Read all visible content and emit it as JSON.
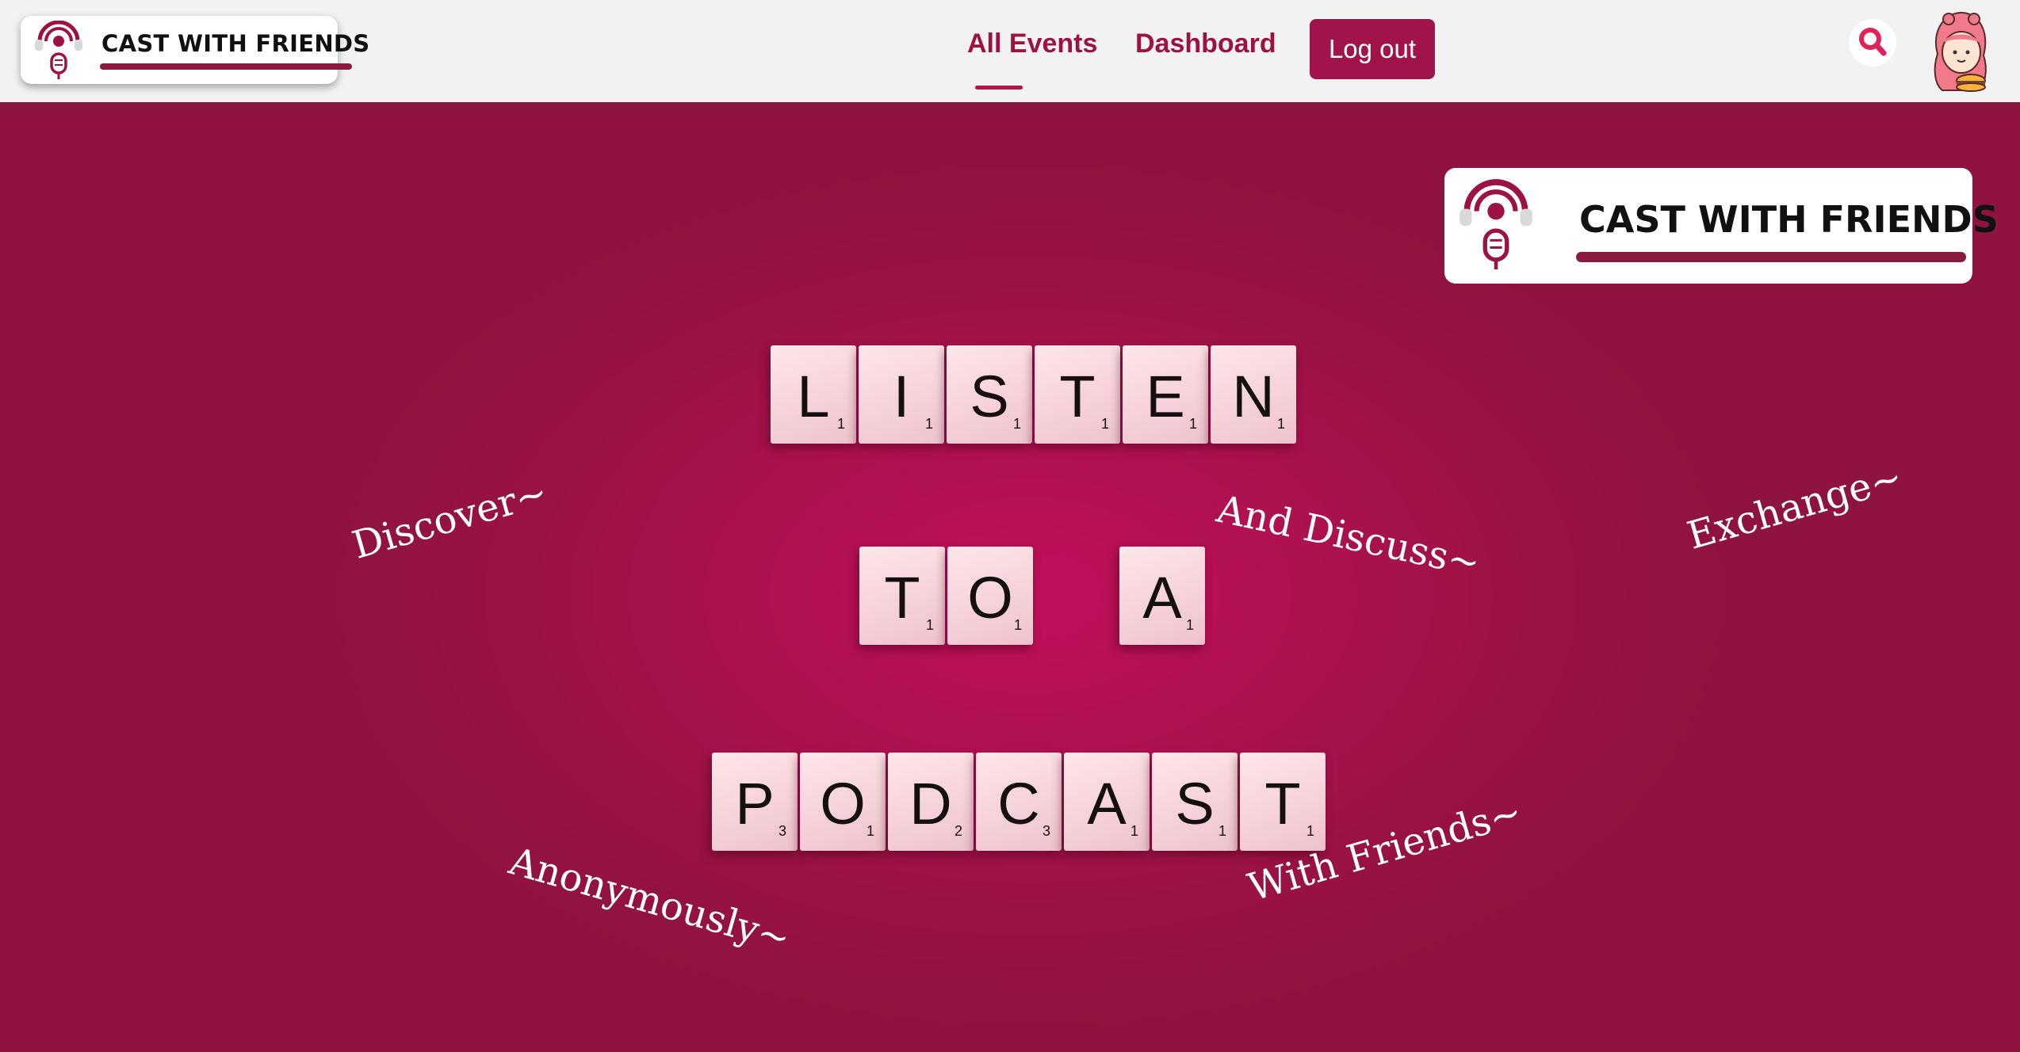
{
  "navbar": {
    "brand": {
      "title": "CAST WITH FRIENDS",
      "icon": "podcast-mic-icon"
    },
    "links": [
      {
        "label": "All Events",
        "active": true
      },
      {
        "label": "Dashboard",
        "active": false
      }
    ],
    "logout_label": "Log out",
    "search_icon": "search-icon",
    "avatar_icon": "user-avatar"
  },
  "hero": {
    "brand": {
      "title": "CAST WITH FRIENDS",
      "icon": "podcast-mic-icon"
    },
    "tile_rows": [
      {
        "word": "LISTEN",
        "tiles": [
          {
            "letter": "L",
            "points": "1"
          },
          {
            "letter": "I",
            "points": "1"
          },
          {
            "letter": "S",
            "points": "1"
          },
          {
            "letter": "T",
            "points": "1"
          },
          {
            "letter": "E",
            "points": "1"
          },
          {
            "letter": "N",
            "points": "1"
          }
        ]
      },
      {
        "word": "TO A",
        "tiles": [
          {
            "letter": "T",
            "points": "1"
          },
          {
            "letter": "O",
            "points": "1"
          },
          {
            "letter": "A",
            "points": "1"
          }
        ]
      },
      {
        "word": "PODCAST",
        "tiles": [
          {
            "letter": "P",
            "points": "3"
          },
          {
            "letter": "O",
            "points": "1"
          },
          {
            "letter": "D",
            "points": "2"
          },
          {
            "letter": "C",
            "points": "3"
          },
          {
            "letter": "A",
            "points": "1"
          },
          {
            "letter": "S",
            "points": "1"
          },
          {
            "letter": "T",
            "points": "1"
          }
        ]
      }
    ],
    "phrases": {
      "discover": "Discover~",
      "and_discuss": "And Discuss~",
      "exchange": "Exchange~",
      "anonymously": "Anonymously~",
      "with_friends": "With Friends~"
    }
  },
  "colors": {
    "brand": "#9c1242",
    "navbar_bg": "#f2f2f2",
    "hero_bg": "#a8114e",
    "search_accent": "#e0225a"
  }
}
